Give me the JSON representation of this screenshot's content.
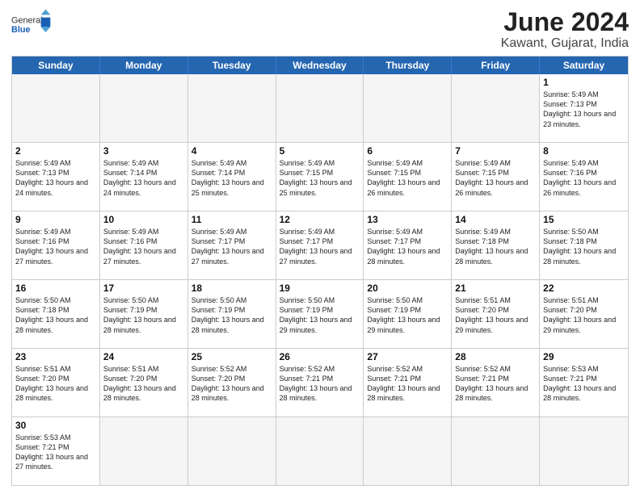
{
  "header": {
    "logo_general": "General",
    "logo_blue": "Blue",
    "month": "June 2024",
    "location": "Kawant, Gujarat, India"
  },
  "weekdays": [
    "Sunday",
    "Monday",
    "Tuesday",
    "Wednesday",
    "Thursday",
    "Friday",
    "Saturday"
  ],
  "rows": [
    [
      {
        "day": "",
        "info": ""
      },
      {
        "day": "",
        "info": ""
      },
      {
        "day": "",
        "info": ""
      },
      {
        "day": "",
        "info": ""
      },
      {
        "day": "",
        "info": ""
      },
      {
        "day": "",
        "info": ""
      },
      {
        "day": "1",
        "info": "Sunrise: 5:49 AM\nSunset: 7:13 PM\nDaylight: 13 hours\nand 23 minutes."
      }
    ],
    [
      {
        "day": "2",
        "info": "Sunrise: 5:49 AM\nSunset: 7:13 PM\nDaylight: 13 hours\nand 24 minutes."
      },
      {
        "day": "3",
        "info": "Sunrise: 5:49 AM\nSunset: 7:14 PM\nDaylight: 13 hours\nand 24 minutes."
      },
      {
        "day": "4",
        "info": "Sunrise: 5:49 AM\nSunset: 7:14 PM\nDaylight: 13 hours\nand 25 minutes."
      },
      {
        "day": "5",
        "info": "Sunrise: 5:49 AM\nSunset: 7:15 PM\nDaylight: 13 hours\nand 25 minutes."
      },
      {
        "day": "6",
        "info": "Sunrise: 5:49 AM\nSunset: 7:15 PM\nDaylight: 13 hours\nand 26 minutes."
      },
      {
        "day": "7",
        "info": "Sunrise: 5:49 AM\nSunset: 7:15 PM\nDaylight: 13 hours\nand 26 minutes."
      },
      {
        "day": "8",
        "info": "Sunrise: 5:49 AM\nSunset: 7:16 PM\nDaylight: 13 hours\nand 26 minutes."
      }
    ],
    [
      {
        "day": "9",
        "info": "Sunrise: 5:49 AM\nSunset: 7:16 PM\nDaylight: 13 hours\nand 27 minutes."
      },
      {
        "day": "10",
        "info": "Sunrise: 5:49 AM\nSunset: 7:16 PM\nDaylight: 13 hours\nand 27 minutes."
      },
      {
        "day": "11",
        "info": "Sunrise: 5:49 AM\nSunset: 7:17 PM\nDaylight: 13 hours\nand 27 minutes."
      },
      {
        "day": "12",
        "info": "Sunrise: 5:49 AM\nSunset: 7:17 PM\nDaylight: 13 hours\nand 27 minutes."
      },
      {
        "day": "13",
        "info": "Sunrise: 5:49 AM\nSunset: 7:17 PM\nDaylight: 13 hours\nand 28 minutes."
      },
      {
        "day": "14",
        "info": "Sunrise: 5:49 AM\nSunset: 7:18 PM\nDaylight: 13 hours\nand 28 minutes."
      },
      {
        "day": "15",
        "info": "Sunrise: 5:50 AM\nSunset: 7:18 PM\nDaylight: 13 hours\nand 28 minutes."
      }
    ],
    [
      {
        "day": "16",
        "info": "Sunrise: 5:50 AM\nSunset: 7:18 PM\nDaylight: 13 hours\nand 28 minutes."
      },
      {
        "day": "17",
        "info": "Sunrise: 5:50 AM\nSunset: 7:19 PM\nDaylight: 13 hours\nand 28 minutes."
      },
      {
        "day": "18",
        "info": "Sunrise: 5:50 AM\nSunset: 7:19 PM\nDaylight: 13 hours\nand 28 minutes."
      },
      {
        "day": "19",
        "info": "Sunrise: 5:50 AM\nSunset: 7:19 PM\nDaylight: 13 hours\nand 29 minutes."
      },
      {
        "day": "20",
        "info": "Sunrise: 5:50 AM\nSunset: 7:19 PM\nDaylight: 13 hours\nand 29 minutes."
      },
      {
        "day": "21",
        "info": "Sunrise: 5:51 AM\nSunset: 7:20 PM\nDaylight: 13 hours\nand 29 minutes."
      },
      {
        "day": "22",
        "info": "Sunrise: 5:51 AM\nSunset: 7:20 PM\nDaylight: 13 hours\nand 29 minutes."
      }
    ],
    [
      {
        "day": "23",
        "info": "Sunrise: 5:51 AM\nSunset: 7:20 PM\nDaylight: 13 hours\nand 28 minutes."
      },
      {
        "day": "24",
        "info": "Sunrise: 5:51 AM\nSunset: 7:20 PM\nDaylight: 13 hours\nand 28 minutes."
      },
      {
        "day": "25",
        "info": "Sunrise: 5:52 AM\nSunset: 7:20 PM\nDaylight: 13 hours\nand 28 minutes."
      },
      {
        "day": "26",
        "info": "Sunrise: 5:52 AM\nSunset: 7:21 PM\nDaylight: 13 hours\nand 28 minutes."
      },
      {
        "day": "27",
        "info": "Sunrise: 5:52 AM\nSunset: 7:21 PM\nDaylight: 13 hours\nand 28 minutes."
      },
      {
        "day": "28",
        "info": "Sunrise: 5:52 AM\nSunset: 7:21 PM\nDaylight: 13 hours\nand 28 minutes."
      },
      {
        "day": "29",
        "info": "Sunrise: 5:53 AM\nSunset: 7:21 PM\nDaylight: 13 hours\nand 28 minutes."
      }
    ],
    [
      {
        "day": "30",
        "info": "Sunrise: 5:53 AM\nSunset: 7:21 PM\nDaylight: 13 hours\nand 27 minutes."
      },
      {
        "day": "",
        "info": ""
      },
      {
        "day": "",
        "info": ""
      },
      {
        "day": "",
        "info": ""
      },
      {
        "day": "",
        "info": ""
      },
      {
        "day": "",
        "info": ""
      },
      {
        "day": "",
        "info": ""
      }
    ]
  ]
}
